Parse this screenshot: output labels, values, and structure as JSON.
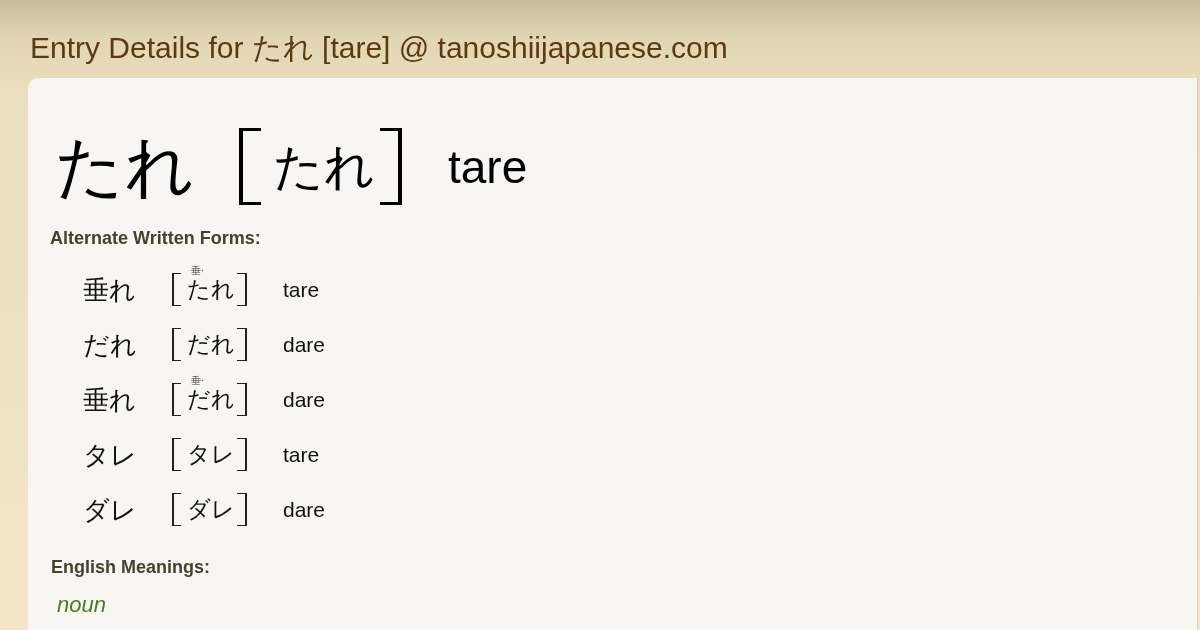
{
  "page_title": "Entry Details for たれ [tare] @ tanoshiijapanese.com",
  "entry": {
    "word": "たれ",
    "reading": "たれ",
    "romaji": "tare"
  },
  "alternate_forms": {
    "heading": "Alternate Written Forms:",
    "forms": [
      {
        "written": "垂れ",
        "reading": "たれ",
        "annotation": "垂·",
        "romaji": "tare"
      },
      {
        "written": "だれ",
        "reading": "だれ",
        "romaji": "dare"
      },
      {
        "written": "垂れ",
        "reading": "だれ",
        "annotation": "垂·",
        "romaji": "dare"
      },
      {
        "written": "タレ",
        "reading": "タレ",
        "romaji": "tare"
      },
      {
        "written": "ダレ",
        "reading": "ダレ",
        "romaji": "dare"
      }
    ]
  },
  "meanings": {
    "heading": "English Meanings:",
    "part_of_speech": "noun"
  }
}
